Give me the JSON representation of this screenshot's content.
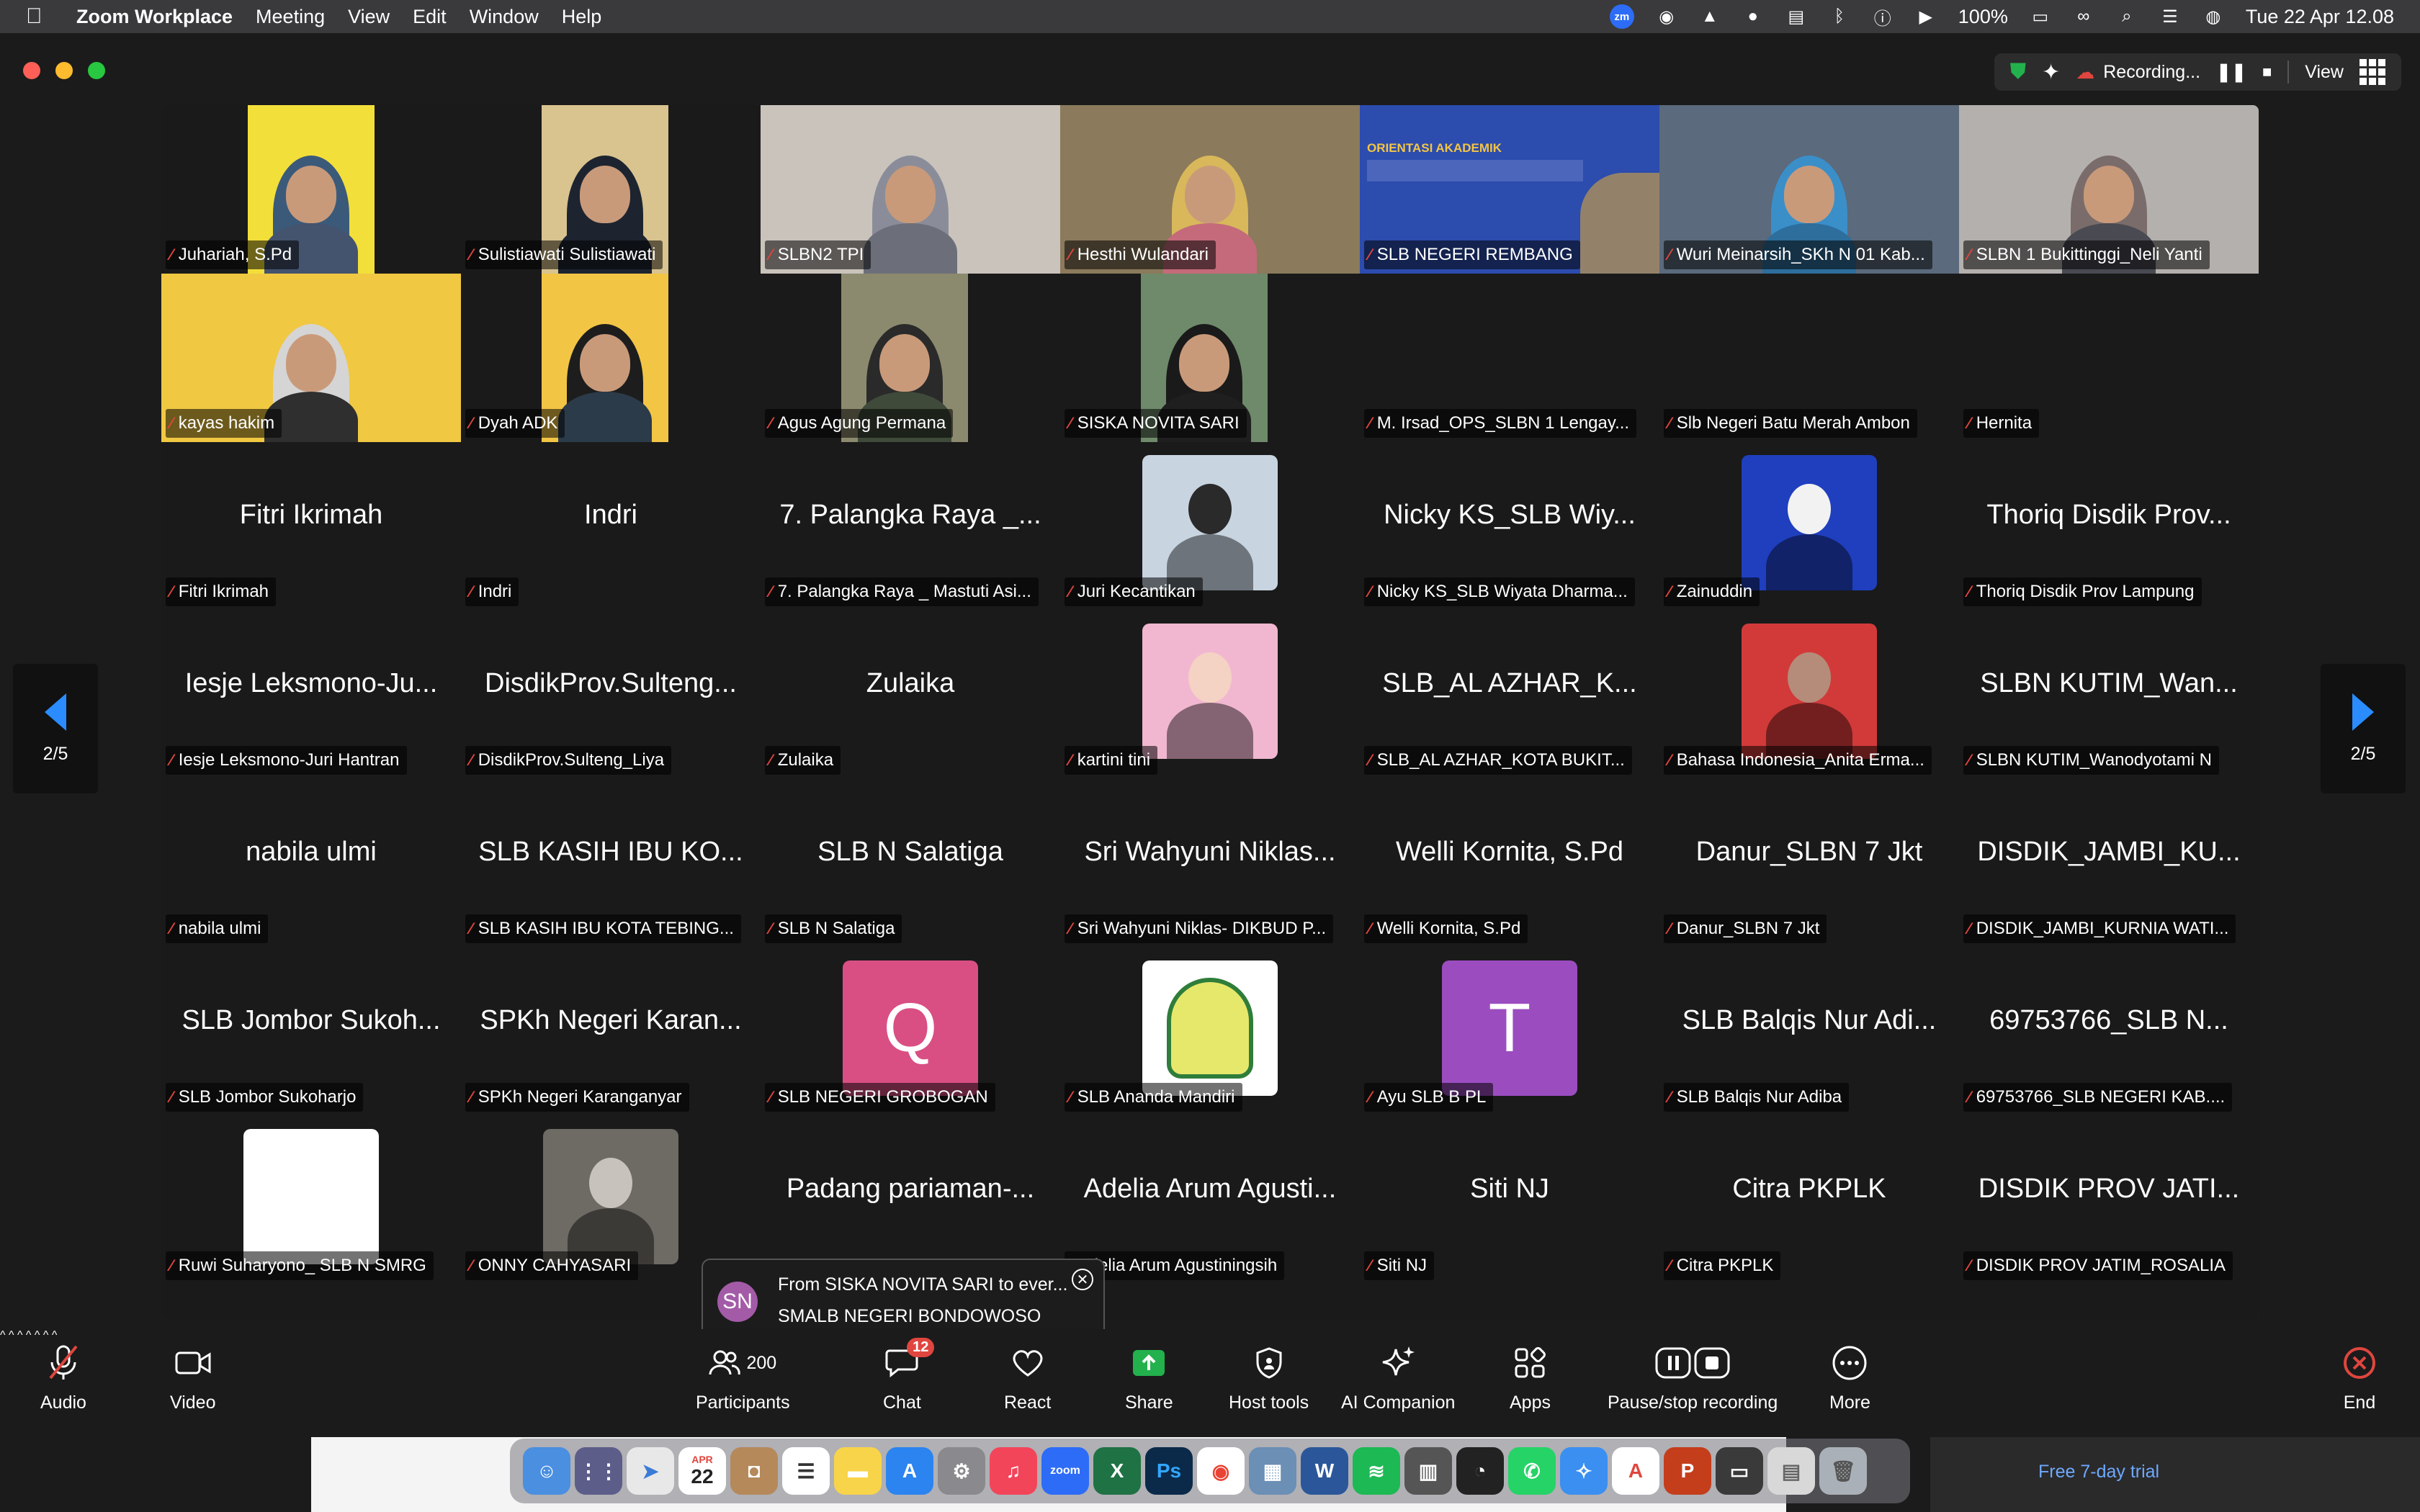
{
  "menubar": {
    "app": "Zoom Workplace",
    "menus": [
      "Meeting",
      "View",
      "Edit",
      "Window",
      "Help"
    ],
    "battery": "100%",
    "datetime": "Tue 22 Apr  12.08"
  },
  "window": {
    "recording_label": "Recording...",
    "view_label": "View"
  },
  "pager": {
    "left": "2/5",
    "right": "2/5"
  },
  "tiles": [
    {
      "name": "Juhariah, S.Pd",
      "big": ""
    },
    {
      "name": "Sulistiawati Sulistiawati",
      "big": ""
    },
    {
      "name": "SLBN2 TPI",
      "big": ""
    },
    {
      "name": "Hesthi Wulandari",
      "big": ""
    },
    {
      "name": "SLB NEGERI REMBANG",
      "big": ""
    },
    {
      "name": "Wuri Meinarsih_SKh N 01 Kab...",
      "big": ""
    },
    {
      "name": "SLBN 1 Bukittinggi_Neli Yanti",
      "big": ""
    },
    {
      "name": "kayas hakim",
      "big": ""
    },
    {
      "name": "Dyah ADK",
      "big": ""
    },
    {
      "name": "Agus Agung Permana",
      "big": ""
    },
    {
      "name": "SISKA NOVITA SARI",
      "big": ""
    },
    {
      "name": "M. Irsad_OPS_SLBN 1 Lengay...",
      "big": ""
    },
    {
      "name": "Slb Negeri Batu Merah Ambon",
      "big": ""
    },
    {
      "name": "Hernita",
      "big": ""
    },
    {
      "name": "Fitri Ikrimah",
      "big": "Fitri Ikrimah"
    },
    {
      "name": "Indri",
      "big": "Indri"
    },
    {
      "name": "7. Palangka Raya _ Mastuti Asi...",
      "big": "7. Palangka Raya _..."
    },
    {
      "name": "Juri Kecantikan",
      "big": ""
    },
    {
      "name": "Nicky KS_SLB Wiyata Dharma...",
      "big": "Nicky KS_SLB Wiy..."
    },
    {
      "name": "Zainuddin",
      "big": ""
    },
    {
      "name": "Thoriq Disdik Prov Lampung",
      "big": "Thoriq Disdik Prov..."
    },
    {
      "name": "Iesje Leksmono-Juri Hantran",
      "big": "Iesje Leksmono-Ju..."
    },
    {
      "name": "DisdikProv.Sulteng_Liya",
      "big": "DisdikProv.Sulteng..."
    },
    {
      "name": "Zulaika",
      "big": "Zulaika"
    },
    {
      "name": "kartini tini",
      "big": ""
    },
    {
      "name": "SLB_AL AZHAR_KOTA BUKIT...",
      "big": "SLB_AL AZHAR_K..."
    },
    {
      "name": "Bahasa Indonesia_Anita Erma...",
      "big": ""
    },
    {
      "name": "SLBN KUTIM_Wanodyotami N",
      "big": "SLBN KUTIM_Wan..."
    },
    {
      "name": "nabila ulmi",
      "big": "nabila ulmi"
    },
    {
      "name": "SLB KASIH IBU KOTA TEBING...",
      "big": "SLB KASIH IBU KO..."
    },
    {
      "name": "SLB N Salatiga",
      "big": "SLB N Salatiga"
    },
    {
      "name": "Sri Wahyuni Niklas- DIKBUD P...",
      "big": "Sri Wahyuni Niklas..."
    },
    {
      "name": "Welli Kornita, S.Pd",
      "big": "Welli Kornita, S.Pd"
    },
    {
      "name": "Danur_SLBN 7 Jkt",
      "big": "Danur_SLBN 7 Jkt"
    },
    {
      "name": "DISDIK_JAMBI_KURNIA WATI...",
      "big": "DISDIK_JAMBI_KU..."
    },
    {
      "name": "SLB Jombor Sukoharjo",
      "big": "SLB Jombor Sukoh..."
    },
    {
      "name": "SPKh Negeri Karanganyar",
      "big": "SPKh Negeri Karan..."
    },
    {
      "name": "SLB NEGERI GROBOGAN",
      "big": "",
      "letter": "Q"
    },
    {
      "name": "SLB Ananda Mandiri",
      "big": ""
    },
    {
      "name": "Ayu SLB B PL",
      "big": "",
      "letter": "T"
    },
    {
      "name": "SLB Balqis Nur Adiba",
      "big": "SLB Balqis Nur Adi..."
    },
    {
      "name": "69753766_SLB NEGERI KAB....",
      "big": "69753766_SLB N..."
    },
    {
      "name": "Ruwi Suharyono_ SLB  N SMRG",
      "big": ""
    },
    {
      "name": "ONNY CAHYASARI",
      "big": ""
    },
    {
      "name": "",
      "big": "Padang pariaman-..."
    },
    {
      "name": "Adelia Arum Agustiningsih",
      "big": "Adelia Arum Agusti..."
    },
    {
      "name": "Siti NJ",
      "big": "Siti NJ"
    },
    {
      "name": "Citra PKPLK",
      "big": "Citra PKPLK"
    },
    {
      "name": "DISDIK PROV JATIM_ROSALIA",
      "big": "DISDIK PROV JATI..."
    }
  ],
  "toast": {
    "initials": "SN",
    "line1": "From SISKA NOVITA SARI to ever...",
    "line2": "SMALB NEGERI BONDOWOSO"
  },
  "toolbar": {
    "audio": "Audio",
    "video": "Video",
    "participants": "Participants",
    "participant_count": "200",
    "chat": "Chat",
    "chat_badge": "12",
    "react": "React",
    "share": "Share",
    "host_tools": "Host tools",
    "ai_companion": "AI Companion",
    "apps": "Apps",
    "pause_recording": "Pause/stop recording",
    "more": "More",
    "end": "End"
  },
  "dock": {
    "calendar_month": "APR",
    "calendar_day": "22",
    "zoom_label": "zoom"
  },
  "background": {
    "trial": "Free 7-day trial"
  },
  "colors": {
    "tile_bg": "#1a1a1a",
    "mute_red": "#e0463f",
    "share_green": "#23b14d",
    "letter_q": "#d94f83",
    "letter_t": "#9b4dc0"
  }
}
